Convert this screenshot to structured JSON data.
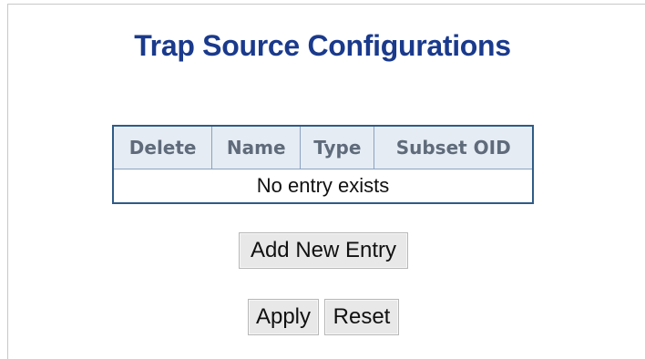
{
  "page": {
    "title": "Trap Source Configurations"
  },
  "table": {
    "headers": {
      "delete": "Delete",
      "name": "Name",
      "type": "Type",
      "subset_oid": "Subset OID"
    },
    "empty_message": "No entry exists"
  },
  "actions": {
    "add_new_entry": "Add New Entry",
    "apply": "Apply",
    "reset": "Reset"
  },
  "colors": {
    "title": "#1a3a8c",
    "table_border": "#2f5b86",
    "header_background": "#e6ecf4",
    "header_text": "#5f6b7a"
  }
}
